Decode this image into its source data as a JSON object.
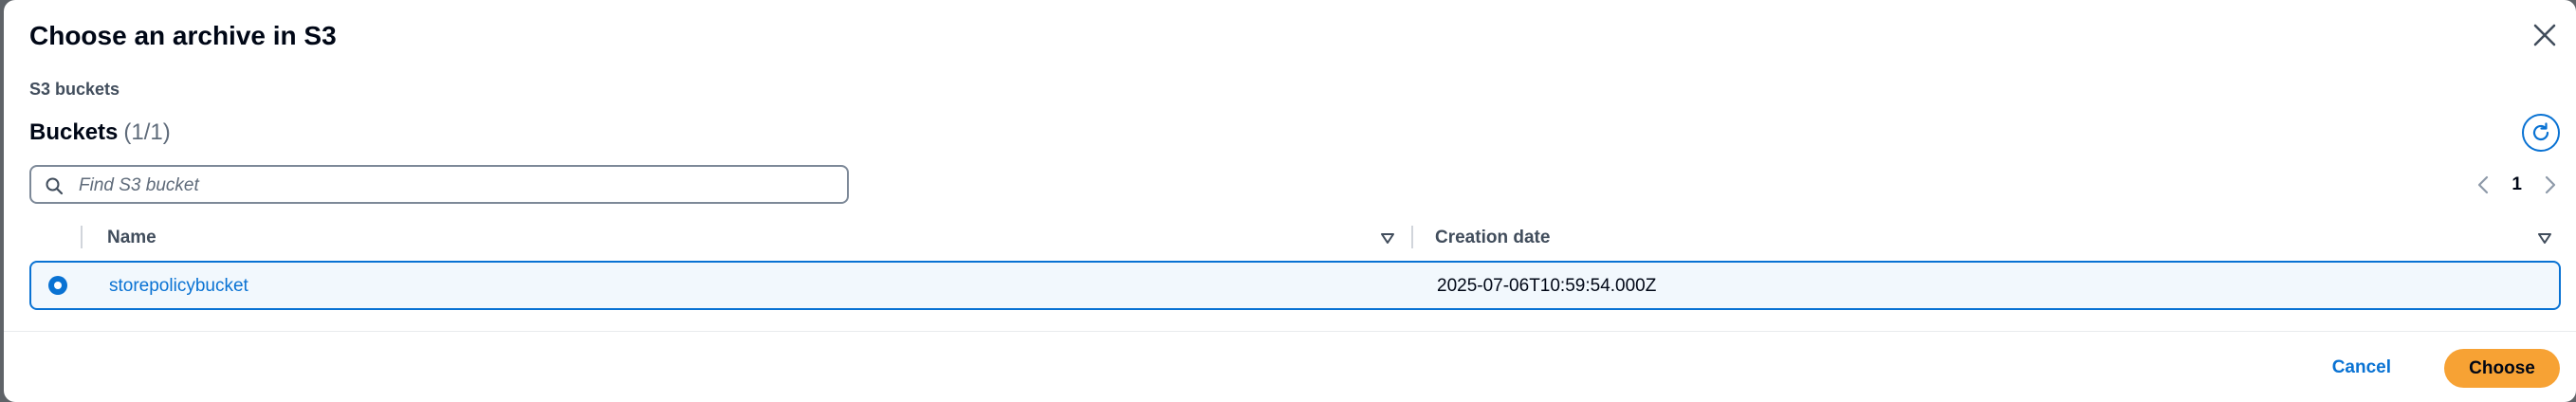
{
  "modal": {
    "title": "Choose an archive in S3"
  },
  "section_label": "S3 buckets",
  "buckets_header": {
    "title": "Buckets",
    "count": "(1/1)"
  },
  "search": {
    "placeholder": "Find S3 bucket",
    "value": ""
  },
  "pagination": {
    "current_page": "1"
  },
  "table": {
    "columns": [
      "Name",
      "Creation date"
    ],
    "rows": [
      {
        "selected": true,
        "name": "storepolicybucket",
        "creation_date": "2025-07-06T10:59:54.000Z"
      }
    ]
  },
  "footer": {
    "cancel_label": "Cancel",
    "choose_label": "Choose"
  },
  "icons": {
    "close": "close-icon",
    "refresh": "refresh-icon",
    "search": "search-icon",
    "prev": "chevron-left-icon",
    "next": "chevron-right-icon",
    "sort": "sort-down-icon",
    "radio": "radio-selected-icon"
  },
  "colors": {
    "accent": "#0972d3",
    "primary_button": "#f7a234",
    "selected_row_bg": "#f2f8fd",
    "text": "#000716"
  }
}
